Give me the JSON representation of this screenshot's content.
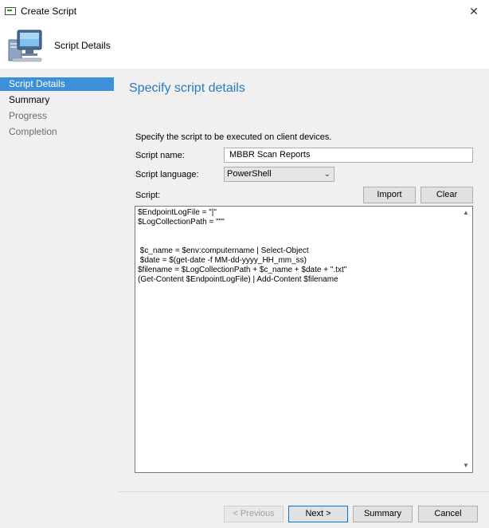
{
  "window": {
    "title": "Create Script",
    "close_glyph": "✕"
  },
  "header": {
    "title": "Script Details"
  },
  "sidebar": {
    "items": [
      {
        "label": "Script Details",
        "state": "active"
      },
      {
        "label": "Summary",
        "state": "normal"
      },
      {
        "label": "Progress",
        "state": "dim"
      },
      {
        "label": "Completion",
        "state": "dim"
      }
    ]
  },
  "main": {
    "heading": "Specify script details",
    "description": "Specify the script to be executed on client devices.",
    "script_name_label": "Script name:",
    "script_name_value": "MBBR Scan Reports",
    "script_language_label": "Script language:",
    "script_language_value": "PowerShell",
    "script_label": "Script:",
    "import_label": "Import",
    "clear_label": "Clear",
    "script_body": "$EndpointLogFile = \"|\"\n$LogCollectionPath = \"\"\"\n\n\n $c_name = $env:computername | Select-Object\n $date = $(get-date -f MM-dd-yyyy_HH_mm_ss)\n$filename = $LogCollectionPath + $c_name + $date + \".txt\"\n(Get-Content $EndpointLogFile) | Add-Content $filename"
  },
  "footer": {
    "previous_label": "< Previous",
    "next_label": "Next >",
    "summary_label": "Summary",
    "cancel_label": "Cancel"
  },
  "colors": {
    "accent": "#3c8fd9",
    "heading": "#2a7ac0",
    "panel_bg": "#f0f0f0"
  },
  "icons": {
    "window_icon": "create-script-window-icon",
    "header_icon": "computer-icon",
    "close": "close-icon",
    "dropdown": "chevron-down-icon"
  }
}
